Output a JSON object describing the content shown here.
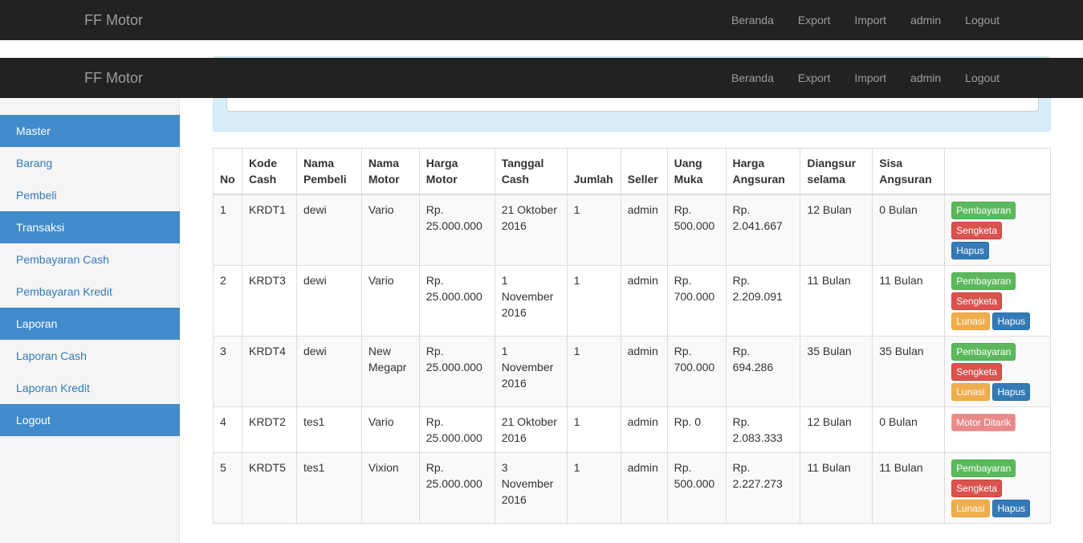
{
  "navbar": {
    "brand": "FF Motor",
    "items": [
      "Beranda",
      "Export",
      "Import",
      "admin",
      "Logout"
    ]
  },
  "sidebar": {
    "items": [
      {
        "label": "Master",
        "type": "header"
      },
      {
        "label": "Barang",
        "type": "link"
      },
      {
        "label": "Pembeli",
        "type": "link"
      },
      {
        "label": "Transaksi",
        "type": "header"
      },
      {
        "label": "Pembayaran Cash",
        "type": "link"
      },
      {
        "label": "Pembayaran Kredit",
        "type": "link"
      },
      {
        "label": "Laporan",
        "type": "header"
      },
      {
        "label": "Laporan Cash",
        "type": "link"
      },
      {
        "label": "Laporan Kredit",
        "type": "link"
      },
      {
        "label": "Logout",
        "type": "header"
      }
    ]
  },
  "table": {
    "headers": [
      "No",
      "Kode Cash",
      "Nama Pembeli",
      "Nama Motor",
      "Harga Motor",
      "Tanggal Cash",
      "Jumlah",
      "Seller",
      "Uang Muka",
      "Harga Angsuran",
      "Diangsur selama",
      "Sisa Angsuran",
      ""
    ],
    "rows": [
      {
        "cells": [
          "1",
          "KRDT1",
          "dewi",
          "Vario",
          "Rp. 25.000.000",
          "21 Oktober 2016",
          "1",
          "admin",
          "Rp. 500.000",
          "Rp. 2.041.667",
          "12 Bulan",
          "0 Bulan"
        ],
        "actions": [
          "Pembayaran",
          "Sengketa",
          "Hapus"
        ]
      },
      {
        "cells": [
          "2",
          "KRDT3",
          "dewi",
          "Vario",
          "Rp. 25.000.000",
          "1 November 2016",
          "1",
          "admin",
          "Rp. 700.000",
          "Rp. 2.209.091",
          "11 Bulan",
          "11 Bulan"
        ],
        "actions": [
          "Pembayaran",
          "Sengketa",
          "Lunasi",
          "Hapus"
        ]
      },
      {
        "cells": [
          "3",
          "KRDT4",
          "dewi",
          "New Megapr",
          "Rp. 25.000.000",
          "1 November 2016",
          "1",
          "admin",
          "Rp. 700.000",
          "Rp. 694.286",
          "35 Bulan",
          "35 Bulan"
        ],
        "actions": [
          "Pembayaran",
          "Sengketa",
          "Lunasi",
          "Hapus"
        ]
      },
      {
        "cells": [
          "4",
          "KRDT2",
          "tes1",
          "Vario",
          "Rp. 25.000.000",
          "21 Oktober 2016",
          "1",
          "admin",
          "Rp. 0",
          "Rp. 2.083.333",
          "12 Bulan",
          "0 Bulan"
        ],
        "actions": [
          "Motor Ditarik"
        ]
      },
      {
        "cells": [
          "5",
          "KRDT5",
          "tes1",
          "Vixion",
          "Rp. 25.000.000",
          "3 November 2016",
          "1",
          "admin",
          "Rp. 500.000",
          "Rp. 2.227.273",
          "11 Bulan",
          "11 Bulan"
        ],
        "actions": [
          "Pembayaran",
          "Sengketa",
          "Lunasi",
          "Hapus"
        ]
      }
    ]
  }
}
